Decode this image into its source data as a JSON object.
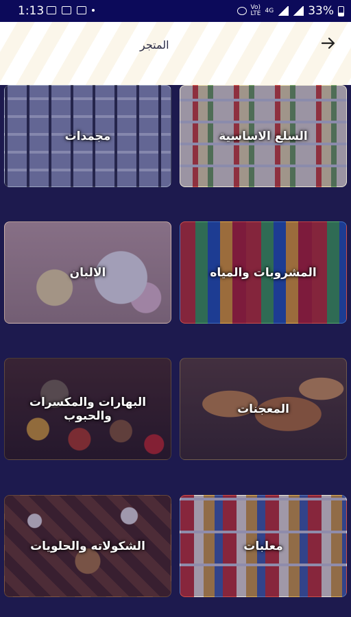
{
  "status_bar": {
    "time": "1:13",
    "battery": "33%",
    "network_top": "Vo)",
    "network_bottom": "LTE",
    "net_type": "4G"
  },
  "header": {
    "title": "المتجر",
    "back_icon": "arrow-right-icon"
  },
  "categories": [
    {
      "label": "السلع الاساسية"
    },
    {
      "label": "مجمدات"
    },
    {
      "label": "المشروبات والمياه"
    },
    {
      "label": "الالبان"
    },
    {
      "label": "المعجنات"
    },
    {
      "label": "البهارات والمكسرات والحبوب"
    },
    {
      "label": "معلبات"
    },
    {
      "label": "الشكولاته والحلويات"
    }
  ],
  "colors": {
    "status_bar": "#0c0a5a",
    "overlay": "#1d1a4e"
  }
}
